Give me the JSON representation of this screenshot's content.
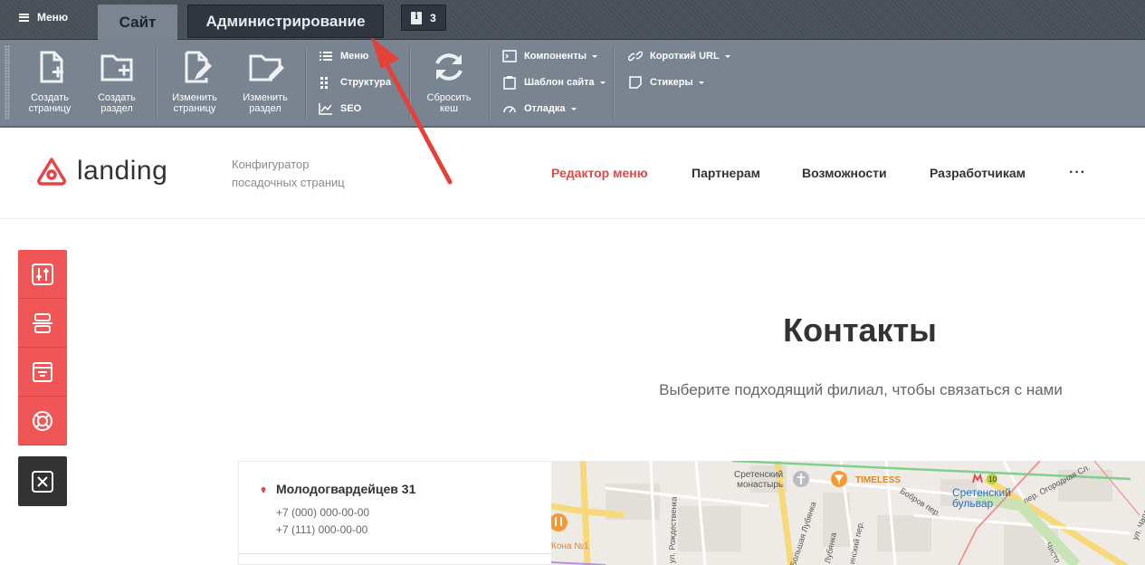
{
  "admin_bar": {
    "menu_label": "Меню",
    "tabs": [
      {
        "label": "Сайт",
        "active": true
      },
      {
        "label": "Администрирование",
        "active": false
      }
    ],
    "notifications_count": "3"
  },
  "toolbar": {
    "create_page": "Создать\nстраницу",
    "create_section": "Создать\nраздел",
    "edit_page": "Изменить\nстраницу",
    "edit_section": "Изменить\nраздел",
    "menu": "Меню",
    "structure": "Структура",
    "seo": "SEO",
    "reset_cache": "Сбросить\nкеш",
    "components": "Компоненты",
    "site_template": "Шаблон сайта",
    "debug": "Отладка",
    "short_url": "Короткий URL",
    "stickers": "Стикеры"
  },
  "site_header": {
    "logo_text": "landing",
    "slogan": "Конфигуратор посадочных страниц",
    "nav": [
      {
        "label": "Редактор меню",
        "active": true
      },
      {
        "label": "Партнерам",
        "active": false
      },
      {
        "label": "Возможности",
        "active": false
      },
      {
        "label": "Разработчикам",
        "active": false
      }
    ],
    "more": "···"
  },
  "side_panel": {
    "icons": [
      "sliders-icon",
      "layout-icon",
      "template-icon",
      "lifebuoy-icon",
      "close-icon"
    ]
  },
  "contacts": {
    "title": "Контакты",
    "subtitle": "Выберите подходящий филиал, чтобы связаться с нами",
    "branch": {
      "address": "Молодогвардейцев 31",
      "phone1": "+7 (000) 000-00-00",
      "phone2": "+7 (111) 000-00-00"
    }
  },
  "map": {
    "labels": {
      "monastery": "Сретенский\nмонастырь",
      "timeless": "TIMELESS",
      "boulevard": "Сретенский\nбульвар",
      "metro_line": "10",
      "sretenka_lane": "ул. Рождественка",
      "bolshaya_lubyanka": "Большая Лубянка",
      "lubyanka2": "Лубянка",
      "bobrov": "Бобров пер.",
      "ogorodnaya": "пер. Огородная Сл.",
      "chistoprudny": "Чисто",
      "ulka": "ул. Чапл",
      "cafe": "Кона №1",
      "kiy": "инский пер."
    }
  }
}
